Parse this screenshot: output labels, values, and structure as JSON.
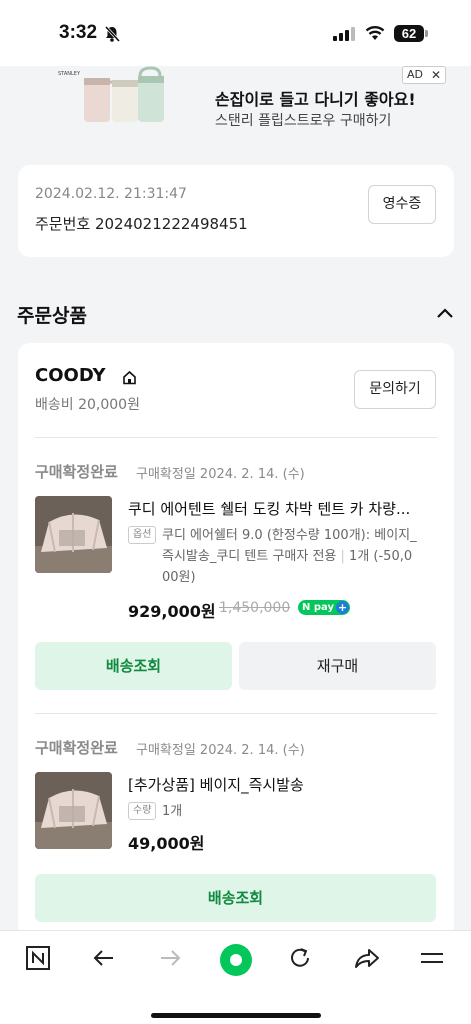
{
  "status_bar": {
    "time": "3:32",
    "battery": "62"
  },
  "ad": {
    "title": "손잡이로 들고 다니기 좋아요!",
    "subtitle": "스탠리 플립스트로우 구매하기",
    "badge": "AD",
    "brand": "STANLEY"
  },
  "order": {
    "datetime": "2024.02.12. 21:31:47",
    "number_label": "주문번호 2024021222498451",
    "receipt_label": "영수증"
  },
  "section": {
    "title": "주문상품"
  },
  "store": {
    "name": "COODY",
    "shipping": "배송비 20,000원",
    "inquiry_label": "문의하기"
  },
  "items": [
    {
      "status": "구매확정완료",
      "status_date": "구매확정일 2024. 2. 14. (수)",
      "title": "쿠디 에어텐트 쉘터 도킹 차박 텐트 카 차량...",
      "option_badge": "옵션",
      "option_line1": "쿠디 에어쉘터 9.0 (한정수량 100개): 베이지_",
      "option_line2": "즉시발송_쿠디 텐트 구매자 전용",
      "option_qty": "1개 (-50,0",
      "option_line3": "00원)",
      "price": "929,000원",
      "old_price": "1,450,000",
      "npay": "N pay",
      "track_label": "배송조회",
      "reorder_label": "재구매"
    },
    {
      "status": "구매확정완료",
      "status_date": "구매확정일 2024. 2. 14. (수)",
      "title": "[추가상품] 베이지_즉시발송",
      "qty_badge": "수량",
      "qty": "1개",
      "price": "49,000원",
      "track_label": "배송조회"
    }
  ]
}
